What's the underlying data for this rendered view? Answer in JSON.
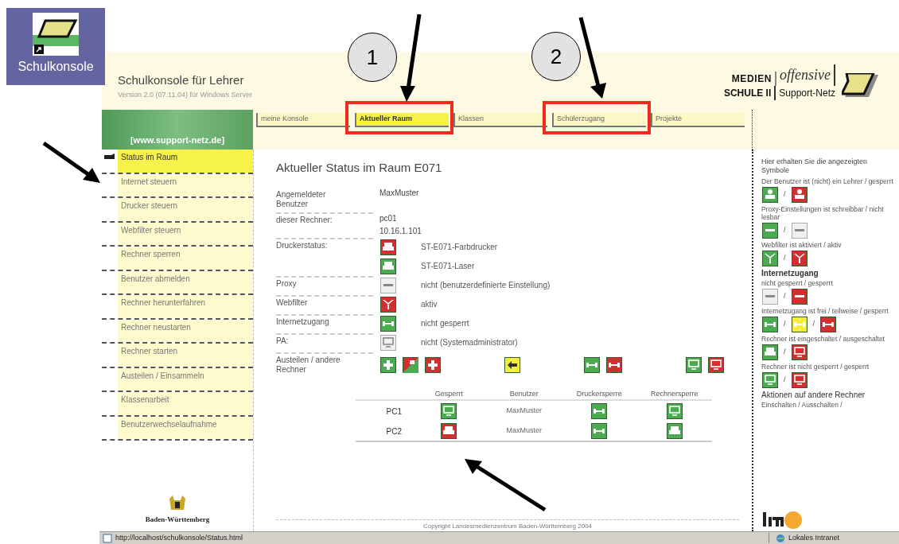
{
  "desktop_icon": {
    "label": "Schulkonsole"
  },
  "callouts": [
    {
      "number": "1"
    },
    {
      "number": "2"
    }
  ],
  "header": {
    "title": "Schulkonsole für Lehrer",
    "subtitle": "Version 2.0 (07.11.04) für Windows Server",
    "logo": {
      "top_left": "MEDIEN",
      "top_right": "offensive",
      "bottom_left": "SCHULE II",
      "bottom_right": "Support-Netz"
    }
  },
  "banner": {
    "text": "[www.support-netz.de]"
  },
  "tabs": [
    {
      "label": "meine Konsole",
      "selected": false,
      "highlighted": false
    },
    {
      "label": "Aktueller Raum",
      "selected": true,
      "highlighted": true
    },
    {
      "label": "Klassen",
      "selected": false,
      "highlighted": false
    },
    {
      "label": "Schülerzugang",
      "selected": false,
      "highlighted": true
    },
    {
      "label": "Projekte",
      "selected": false,
      "highlighted": false
    }
  ],
  "sidebar": {
    "items": [
      {
        "label": "Status im Raum",
        "selected": true
      },
      {
        "label": "Internet steuern",
        "selected": false
      },
      {
        "label": "Drucker steuern",
        "selected": false
      },
      {
        "label": "Webfilter steuern",
        "selected": false
      },
      {
        "label": "Rechner sperren",
        "selected": false
      },
      {
        "label": "Benutzer abmelden",
        "selected": false
      },
      {
        "label": "Rechner herunterfahren",
        "selected": false
      },
      {
        "label": "Rechner neustarten",
        "selected": false
      },
      {
        "label": "Rechner starten",
        "selected": false
      },
      {
        "label": "Austeilen / Einsammeln",
        "selected": false
      },
      {
        "label": "Klassenarbeit",
        "selected": false
      },
      {
        "label": "Benutzerwechselaufnahme",
        "selected": false
      }
    ],
    "footer_logo": "Baden-Württemberg"
  },
  "content": {
    "title": "Aktueller Status im Raum E071",
    "rows": [
      {
        "label": "Angemeldeter Benutzer",
        "entries": [
          {
            "text": "MaxMuster"
          }
        ]
      },
      {
        "label": "dieser Rechner:",
        "entries": [
          {
            "text": "pc01"
          },
          {
            "text": "10.16.1.101"
          }
        ]
      },
      {
        "label": "Druckerstatus:",
        "entries": [
          {
            "icon": {
              "kind": "printer",
              "color": "#d13030"
            },
            "text": "ST-E071-Farbdrucker"
          },
          {
            "icon": {
              "kind": "printer",
              "color": "#4caa50"
            },
            "text": "ST-E071-Laser"
          }
        ]
      },
      {
        "label": "Proxy",
        "entries": [
          {
            "icon": {
              "kind": "dash",
              "color": "#f0f0f0"
            },
            "text": "nicht (benutzerdefinierte Einstellung)"
          }
        ]
      },
      {
        "label": "Webfilter",
        "entries": [
          {
            "icon": {
              "kind": "funnel",
              "color": "#d13030"
            },
            "text": "aktiv"
          }
        ]
      },
      {
        "label": "Internetzugang",
        "entries": [
          {
            "icon": {
              "kind": "network",
              "color": "#4caa50"
            },
            "text": "nicht gesperrt"
          }
        ]
      },
      {
        "label": "PA:",
        "entries": [
          {
            "icon": {
              "kind": "monitor",
              "color": "#f0f0f0"
            },
            "text": "nicht (Systemadministrator)"
          }
        ]
      }
    ],
    "actions": {
      "label": "Austeilen / andere Rechner",
      "groups": [
        [
          {
            "kind": "plus",
            "color": "#4caa50"
          },
          {
            "kind": "split",
            "color": "#d13030"
          },
          {
            "kind": "plus",
            "color": "#d13030"
          }
        ],
        [
          {
            "kind": "arrow",
            "color": "#f5ef3c"
          }
        ],
        [
          {
            "kind": "network",
            "color": "#4caa50"
          },
          {
            "kind": "network",
            "color": "#d13030"
          }
        ],
        [
          {
            "kind": "monitor",
            "color": "#4caa50"
          },
          {
            "kind": "monitor",
            "color": "#d13030"
          }
        ]
      ]
    },
    "table": {
      "columns": [
        "Gesperrt",
        "Benutzer",
        "Druckersperre",
        "Rechnersperre"
      ],
      "rows": [
        {
          "name": "PC1",
          "cells": [
            {
              "icon": {
                "kind": "monitor",
                "color": "#4caa50"
              }
            },
            {
              "text": "MaxMuster"
            },
            {
              "icon": {
                "kind": "network",
                "color": "#4caa50"
              }
            },
            {
              "icon": {
                "kind": "monitor",
                "color": "#4caa50"
              }
            }
          ]
        },
        {
          "name": "PC2",
          "cells": [
            {
              "icon": {
                "kind": "printer",
                "color": "#d13030"
              }
            },
            {
              "text": "MaxMuster"
            },
            {
              "icon": {
                "kind": "network",
                "color": "#4caa50"
              }
            },
            {
              "icon": {
                "kind": "printer",
                "color": "#4caa50"
              }
            }
          ]
        }
      ]
    },
    "footer": "Copyright Landesmedienzentrum Baden-Württemberg 2004"
  },
  "legend": {
    "title": "Hier erhalten Sie die angezeigten Symbole",
    "items": [
      {
        "text": "Der Benutzer ist (nicht) ein Lehrer / gesperrt",
        "separator": "/",
        "icons": [
          {
            "kind": "person",
            "color": "#4caa50"
          },
          {
            "kind": "person",
            "color": "#d13030"
          }
        ]
      },
      {
        "text": "Proxy-Einstellungen ist schreibbar / nicht lesbar",
        "separator": "/",
        "icons": [
          {
            "kind": "dash",
            "color": "#4caa50"
          },
          {
            "kind": "dash",
            "color": "#f0f0f0"
          }
        ]
      },
      {
        "text": "Webfilter ist aktiviert / aktiv",
        "separator": "/",
        "icons": [
          {
            "kind": "funnel",
            "color": "#4caa50"
          },
          {
            "kind": "funnel",
            "color": "#d13030"
          }
        ]
      },
      {
        "heading": "Internetzugang",
        "text": "nicht gesperrt / gesperrt",
        "separator": "/",
        "icons": [
          {
            "kind": "dash",
            "color": "#f0f0f0"
          },
          {
            "kind": "dash",
            "color": "#d13030"
          }
        ]
      },
      {
        "text": "Internetzugang ist frei / teilweise / gesperrt",
        "separator": "/",
        "icons": [
          {
            "kind": "network",
            "color": "#4caa50"
          },
          {
            "kind": "network",
            "color": "#f5ef3c"
          },
          {
            "kind": "network",
            "color": "#d13030"
          }
        ]
      },
      {
        "text": "Rechner ist eingeschaltet / ausgeschaltet",
        "separator": "/",
        "icons": [
          {
            "kind": "printer",
            "color": "#4caa50"
          },
          {
            "kind": "monitor",
            "color": "#d13030"
          }
        ]
      },
      {
        "text": "Rechner ist nicht gesperrt / gesperrt",
        "separator": "/",
        "icons": [
          {
            "kind": "monitor",
            "color": "#4caa50"
          },
          {
            "kind": "monitor",
            "color": "#d13030"
          }
        ]
      },
      {
        "heading": "Aktionen auf andere Rechner",
        "text": "Einschalten / Ausschalten /"
      }
    ]
  },
  "status_bar": {
    "url": "http://localhost/schulkonsole/Status.html",
    "zone": "Lokales Intranet"
  }
}
